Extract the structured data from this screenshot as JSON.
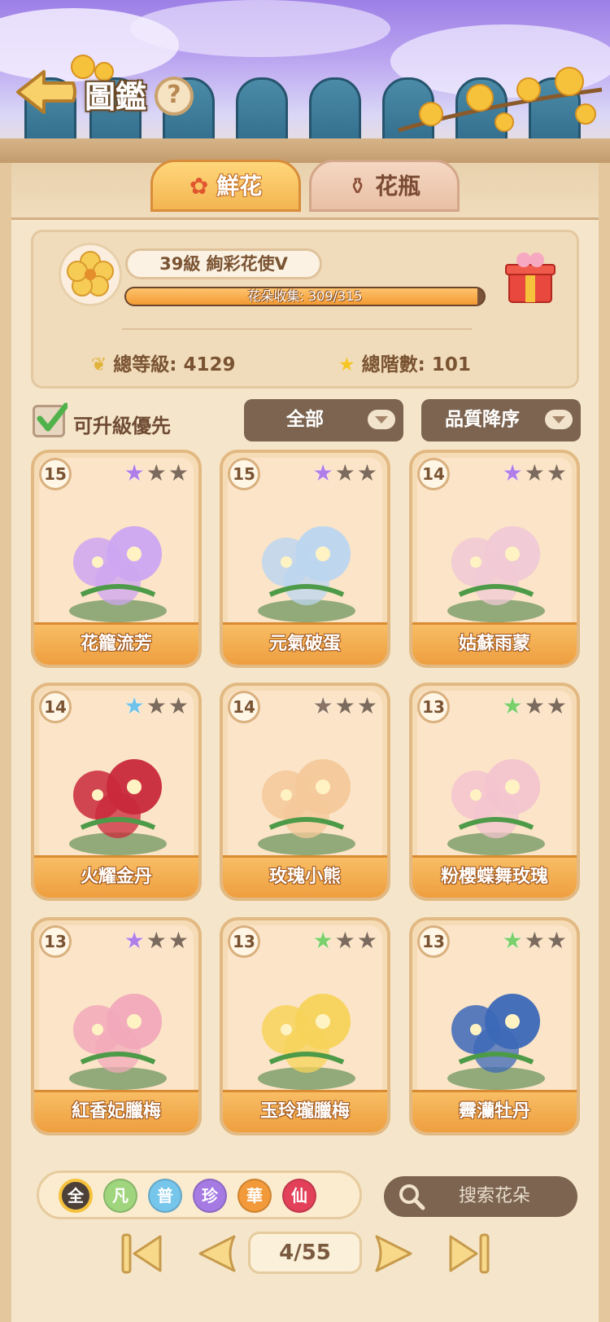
{
  "header": {
    "title": "圖鑑",
    "help": "?"
  },
  "tabs": [
    {
      "label": "鮮花",
      "active": true
    },
    {
      "label": "花瓶",
      "active": false
    }
  ],
  "profile": {
    "level_text": "39級  絢彩花使Ⅴ",
    "progress_text": "花朵收集: 309/315",
    "progress": 0.981,
    "total_level": "總等級: 4129",
    "total_rank": "總階數: 101"
  },
  "filters": {
    "upgrade_priority": "可升級優先",
    "upgrade_checked": true,
    "category": "全部",
    "sort": "品質降序"
  },
  "cards": [
    {
      "level": "15",
      "name": "花籠流芳",
      "star": "#b07ee8",
      "art": "#cda6f2"
    },
    {
      "level": "15",
      "name": "元氣破蛋",
      "star": "#b07ee8",
      "art": "#bcd6f0"
    },
    {
      "level": "14",
      "name": "姑蘇雨蒙",
      "star": "#b07ee8",
      "art": "#f0c9d6"
    },
    {
      "level": "14",
      "name": "火耀金丹",
      "star": "#6fc3ea",
      "art": "#c9293b"
    },
    {
      "level": "14",
      "name": "玫瑰小熊",
      "star": "#8b7466",
      "art": "#f4c89a"
    },
    {
      "level": "13",
      "name": "粉櫻蝶舞玫瑰",
      "star": "#7ad06a",
      "art": "#f3c4cf"
    },
    {
      "level": "13",
      "name": "紅香妃臘梅",
      "star": "#b07ee8",
      "art": "#f1a9ba"
    },
    {
      "level": "13",
      "name": "玉玲瓏臘梅",
      "star": "#7ad06a",
      "art": "#f7d35a"
    },
    {
      "level": "13",
      "name": "霽灡牡丹",
      "star": "#7ad06a",
      "art": "#3c68b8"
    }
  ],
  "quality_chips": [
    {
      "label": "全",
      "color": "#4d4038"
    },
    {
      "label": "凡",
      "color": "#9fd57d"
    },
    {
      "label": "普",
      "color": "#76c5ea"
    },
    {
      "label": "珍",
      "color": "#a57be3"
    },
    {
      "label": "華",
      "color": "#f29a3a"
    },
    {
      "label": "仙",
      "color": "#e3405a"
    }
  ],
  "search": {
    "placeholder": "搜索花朵"
  },
  "pagination": {
    "current": "4/55"
  }
}
